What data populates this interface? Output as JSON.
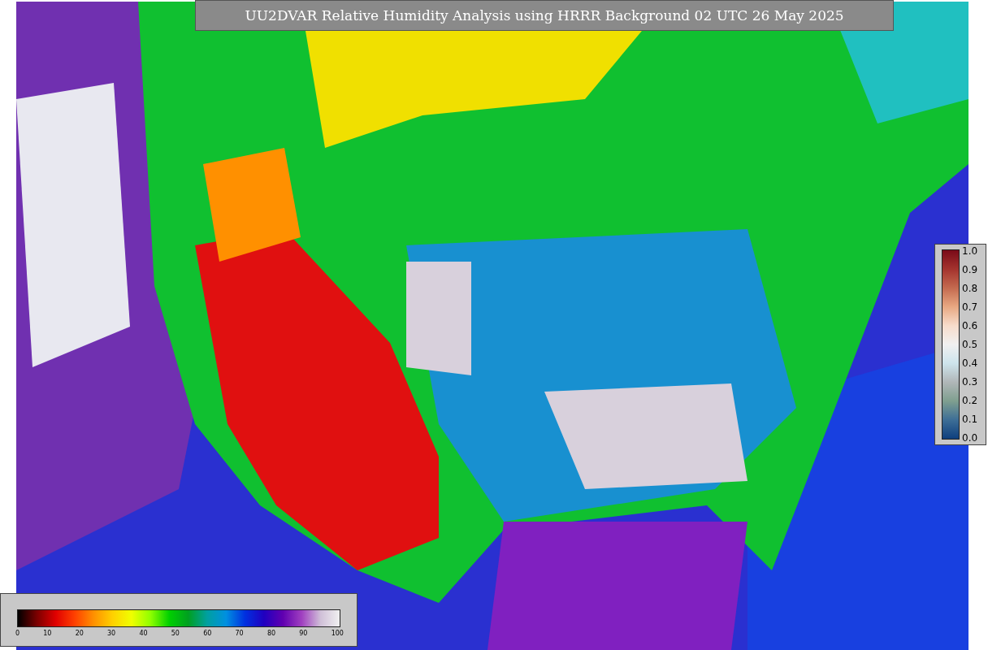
{
  "title": "UU2DVAR Relative Humidity Analysis using HRRR Background 02 UTC 26 May 2025",
  "side_legend": {
    "ticks": [
      "1.0",
      "0.9",
      "0.8",
      "0.7",
      "0.6",
      "0.5",
      "0.4",
      "0.3",
      "0.2",
      "0.1",
      "0.0"
    ]
  },
  "bottom_legend": {
    "ticks": [
      "0",
      "10",
      "20",
      "30",
      "40",
      "50",
      "60",
      "70",
      "80",
      "90",
      "100"
    ]
  }
}
